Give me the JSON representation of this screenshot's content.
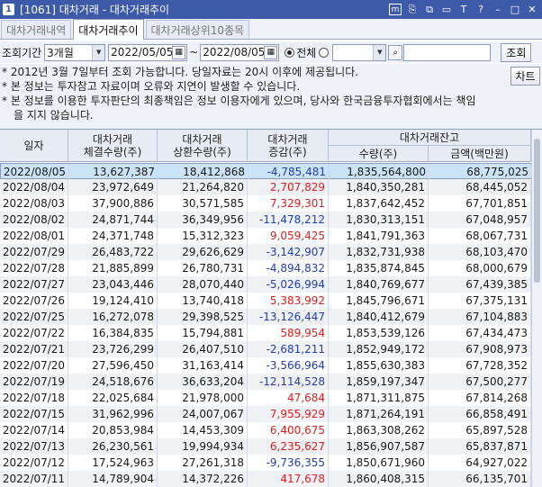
{
  "window": {
    "screen_no": "1",
    "title": "[1061] 대차거래 - 대차거래추이",
    "controls": [
      "m",
      "⎘",
      "⧉",
      "▭",
      "T",
      "?",
      "–",
      "□",
      "✕"
    ]
  },
  "tabs": [
    {
      "label": "대차거래내역",
      "active": false
    },
    {
      "label": "대차거래추이",
      "active": true
    },
    {
      "label": "대차거래상위10종목",
      "active": false
    }
  ],
  "query": {
    "period_label": "조회기간",
    "period_value": "3개월",
    "start_date": "2022/05/05",
    "separator": "~",
    "end_date": "2022/08/05",
    "radio_all_label": "전체",
    "radio_all_checked": true,
    "stock_select_value": "",
    "stock_name_value": "",
    "search_button": "조회",
    "chart_button": "차트"
  },
  "notes": [
    "* 2012년 3월 7일부터 조회 가능합니다. 당일자료는 20시 이후에 제공됩니다.",
    "* 본 정보는 투자참고 자료이며 오류와 지연이 발생할 수 있습니다.",
    "* 본 정보를 이용한 투자판단의 최종책임은 정보 이용자에게 있으며, 당사와 한국금융투자협회에서는 책임",
    "을 지지 않습니다."
  ],
  "table": {
    "headers": {
      "date": "일자",
      "contract": "대차거래\n체결수량(주)",
      "repay": "대차거래\n상환수량(주)",
      "change": "대차거래\n증감(주)",
      "balance_group": "대차거래잔고",
      "balance_qty": "수량(주)",
      "balance_amt": "금액(백만원)"
    },
    "rows": [
      {
        "date": "2022/08/05",
        "contract": "13,627,387",
        "repay": "18,412,868",
        "change": "-4,785,481",
        "sign": "neg",
        "qty": "1,835,564,800",
        "amt": "68,775,025"
      },
      {
        "date": "2022/08/04",
        "contract": "23,972,649",
        "repay": "21,264,820",
        "change": "2,707,829",
        "sign": "pos",
        "qty": "1,840,350,281",
        "amt": "68,445,052"
      },
      {
        "date": "2022/08/03",
        "contract": "37,900,886",
        "repay": "30,571,585",
        "change": "7,329,301",
        "sign": "pos",
        "qty": "1,837,642,452",
        "amt": "67,701,851"
      },
      {
        "date": "2022/08/02",
        "contract": "24,871,744",
        "repay": "36,349,956",
        "change": "-11,478,212",
        "sign": "neg",
        "qty": "1,830,313,151",
        "amt": "67,048,957"
      },
      {
        "date": "2022/08/01",
        "contract": "24,371,748",
        "repay": "15,312,323",
        "change": "9,059,425",
        "sign": "pos",
        "qty": "1,841,791,363",
        "amt": "68,067,731"
      },
      {
        "date": "2022/07/29",
        "contract": "26,483,722",
        "repay": "29,626,629",
        "change": "-3,142,907",
        "sign": "neg",
        "qty": "1,832,731,938",
        "amt": "68,103,470"
      },
      {
        "date": "2022/07/28",
        "contract": "21,885,899",
        "repay": "26,780,731",
        "change": "-4,894,832",
        "sign": "neg",
        "qty": "1,835,874,845",
        "amt": "68,000,679"
      },
      {
        "date": "2022/07/27",
        "contract": "23,043,446",
        "repay": "28,070,440",
        "change": "-5,026,994",
        "sign": "neg",
        "qty": "1,840,769,677",
        "amt": "67,439,385"
      },
      {
        "date": "2022/07/26",
        "contract": "19,124,410",
        "repay": "13,740,418",
        "change": "5,383,992",
        "sign": "pos",
        "qty": "1,845,796,671",
        "amt": "67,375,131"
      },
      {
        "date": "2022/07/25",
        "contract": "16,272,078",
        "repay": "29,398,525",
        "change": "-13,126,447",
        "sign": "neg",
        "qty": "1,840,412,679",
        "amt": "67,104,883"
      },
      {
        "date": "2022/07/22",
        "contract": "16,384,835",
        "repay": "15,794,881",
        "change": "589,954",
        "sign": "pos",
        "qty": "1,853,539,126",
        "amt": "67,434,473"
      },
      {
        "date": "2022/07/21",
        "contract": "23,726,299",
        "repay": "26,407,510",
        "change": "-2,681,211",
        "sign": "neg",
        "qty": "1,852,949,172",
        "amt": "67,908,973"
      },
      {
        "date": "2022/07/20",
        "contract": "27,596,450",
        "repay": "31,163,414",
        "change": "-3,566,964",
        "sign": "neg",
        "qty": "1,855,630,383",
        "amt": "67,728,352"
      },
      {
        "date": "2022/07/19",
        "contract": "24,518,676",
        "repay": "36,633,204",
        "change": "-12,114,528",
        "sign": "neg",
        "qty": "1,859,197,347",
        "amt": "67,500,277"
      },
      {
        "date": "2022/07/18",
        "contract": "22,025,684",
        "repay": "21,978,000",
        "change": "47,684",
        "sign": "pos",
        "qty": "1,871,311,875",
        "amt": "67,814,268"
      },
      {
        "date": "2022/07/15",
        "contract": "31,962,996",
        "repay": "24,007,067",
        "change": "7,955,929",
        "sign": "pos",
        "qty": "1,871,264,191",
        "amt": "66,858,491"
      },
      {
        "date": "2022/07/14",
        "contract": "20,853,984",
        "repay": "14,453,309",
        "change": "6,400,675",
        "sign": "pos",
        "qty": "1,863,308,262",
        "amt": "65,897,528"
      },
      {
        "date": "2022/07/13",
        "contract": "26,230,561",
        "repay": "19,994,934",
        "change": "6,235,627",
        "sign": "pos",
        "qty": "1,856,907,587",
        "amt": "65,837,871"
      },
      {
        "date": "2022/07/12",
        "contract": "17,524,963",
        "repay": "27,261,318",
        "change": "-9,736,355",
        "sign": "neg",
        "qty": "1,850,671,960",
        "amt": "64,927,022"
      },
      {
        "date": "2022/07/11",
        "contract": "14,789,904",
        "repay": "14,372,226",
        "change": "417,678",
        "sign": "pos",
        "qty": "1,860,408,315",
        "amt": "66,135,701"
      }
    ]
  }
}
